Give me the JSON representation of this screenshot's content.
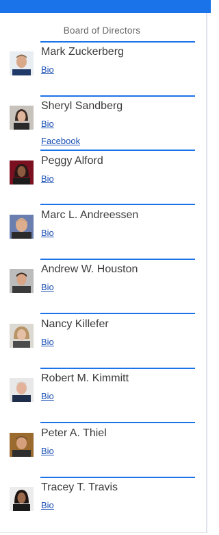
{
  "title": "Board of Directors",
  "colors": {
    "accent": "#1a73e8",
    "link": "#1a4fb4"
  },
  "members": [
    {
      "name": "Mark Zuckerberg",
      "bio_label": "Bio"
    },
    {
      "name": "Sheryl Sandberg",
      "bio_label": "Bio",
      "extra_label": "Facebook"
    },
    {
      "name": "Peggy Alford",
      "bio_label": "Bio"
    },
    {
      "name": "Marc L. Andreessen",
      "bio_label": "Bio"
    },
    {
      "name": "Andrew W. Houston",
      "bio_label": "Bio"
    },
    {
      "name": "Nancy Killefer",
      "bio_label": "Bio"
    },
    {
      "name": "Robert M. Kimmitt",
      "bio_label": "Bio"
    },
    {
      "name": "Peter A. Thiel",
      "bio_label": "Bio"
    },
    {
      "name": "Tracey T. Travis",
      "bio_label": "Bio"
    }
  ]
}
